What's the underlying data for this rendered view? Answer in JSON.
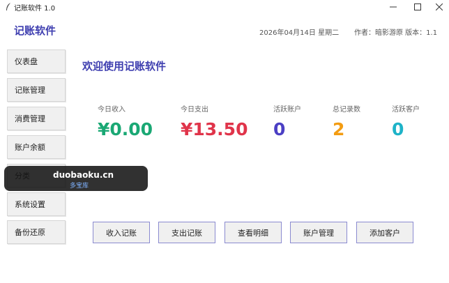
{
  "window": {
    "title": "记账软件 1.0",
    "controls": {
      "minimize": "–",
      "maximize": "☐",
      "close": "✕"
    }
  },
  "header": {
    "app_title": "记账软件",
    "date": "2026年04月14日 星期二",
    "author": "作者：暗影游原 版本：1.1"
  },
  "sidebar": {
    "items": [
      {
        "label": "仪表盘"
      },
      {
        "label": "记账管理"
      },
      {
        "label": "消费管理"
      },
      {
        "label": "账户余额"
      },
      {
        "label": "分类"
      },
      {
        "label": "系统设置"
      },
      {
        "label": "备份还原"
      }
    ]
  },
  "main": {
    "welcome": "欢迎使用记账软件",
    "stats": [
      {
        "label": "今日收入",
        "value": "¥0.00",
        "color": "#1aa874"
      },
      {
        "label": "今日支出",
        "value": "¥13.50",
        "color": "#e0344a"
      },
      {
        "label": "活跃账户",
        "value": "0",
        "color": "#4b3fc4"
      },
      {
        "label": "总记录数",
        "value": "2",
        "color": "#f39c12"
      },
      {
        "label": "活跃客户",
        "value": "0",
        "color": "#1eb3c8"
      }
    ],
    "actions": [
      {
        "label": "收入记账"
      },
      {
        "label": "支出记账"
      },
      {
        "label": "查看明细"
      },
      {
        "label": "账户管理"
      },
      {
        "label": "添加客户"
      }
    ]
  },
  "watermark": {
    "main": "duobaoku.cn",
    "sub": "多宝库"
  }
}
